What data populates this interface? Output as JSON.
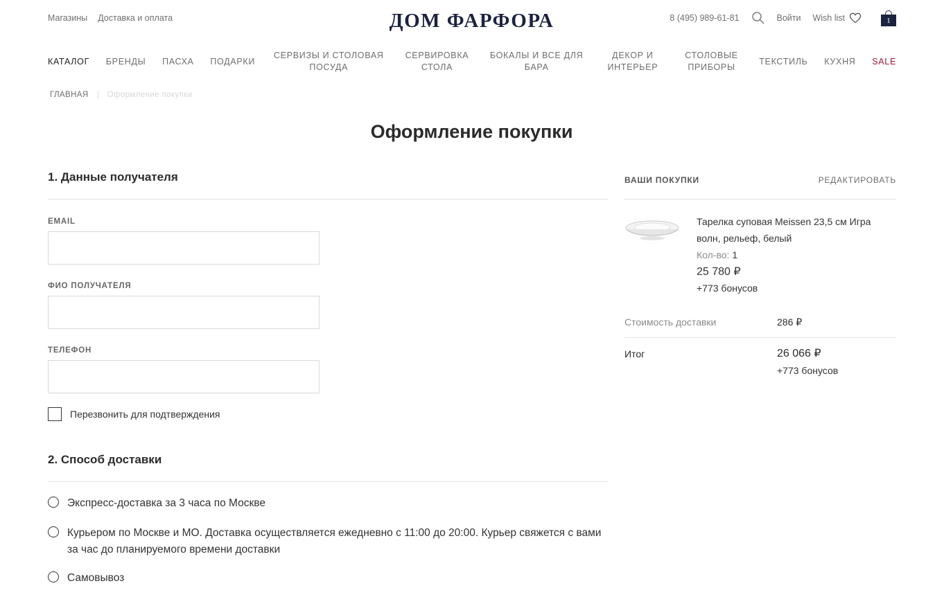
{
  "header": {
    "links": [
      "Магазины",
      "Доставка и оплата"
    ],
    "logo": "ДОМ ФАРФОРА",
    "phone": "8 (495) 989-61-81",
    "login": "Войти",
    "wishlist": "Wish list",
    "cart_count": "1"
  },
  "nav": {
    "items": [
      "КАТАЛОГ",
      "БРЕНДЫ",
      "ПАСХА",
      "ПОДАРКИ",
      "СЕРВИЗЫ И СТОЛОВАЯ ПОСУДА",
      "СЕРВИРОВКА СТОЛА",
      "БОКАЛЫ И ВСЕ ДЛЯ БАРА",
      "ДЕКОР И ИНТЕРЬЕР",
      "СТОЛОВЫЕ ПРИБОРЫ",
      "ТЕКСТИЛЬ",
      "КУХНЯ",
      "SALE"
    ],
    "active": "КАТАЛОГ"
  },
  "breadcrumb": {
    "home": "ГЛАВНАЯ",
    "current": "Оформление покупки"
  },
  "page_title": "Оформление покупки",
  "recipient": {
    "title": "1. Данные получателя",
    "email_label": "EMAIL",
    "email_value": "",
    "name_label": "ФИО ПОЛУЧАТЕЛЯ",
    "name_value": "",
    "phone_label": "ТЕЛЕФОН",
    "phone_value": "",
    "callback_label": "Перезвонить для подтверждения",
    "callback_checked": false
  },
  "delivery": {
    "title": "2. Способ доставки",
    "options": [
      "Экспресс-доставка за 3 часа по Москве",
      "Курьером по Москве и МО. Доставка осуществляется ежедневно с 11:00 до 20:00. Курьер свяжется с вами за час до планируемого времени доставки",
      "Самовывоз"
    ]
  },
  "cart": {
    "title": "ВАШИ ПОКУПКИ",
    "edit": "РЕДАКТИРОВАТЬ",
    "item": {
      "name": "Тарелка суповая Meissen 23,5 см Игра волн, рельеф, белый",
      "qty_label": "Кол-во:",
      "qty": "1",
      "price": "25 780 ₽",
      "bonus": "+773 бонусов"
    },
    "delivery_label": "Стоимость доставки",
    "delivery_cost": "286 ₽",
    "total_label": "Итог",
    "total": "26 066 ₽",
    "total_bonus": "+773 бонусов"
  },
  "colors": {
    "brand": "#1c2340",
    "sale": "#9a1b35",
    "text": "#2b2b2b",
    "muted": "#6d6d6d",
    "rule": "#e3e3e3"
  },
  "icons": [
    "search-icon",
    "heart-icon",
    "shopping-bag-icon"
  ]
}
